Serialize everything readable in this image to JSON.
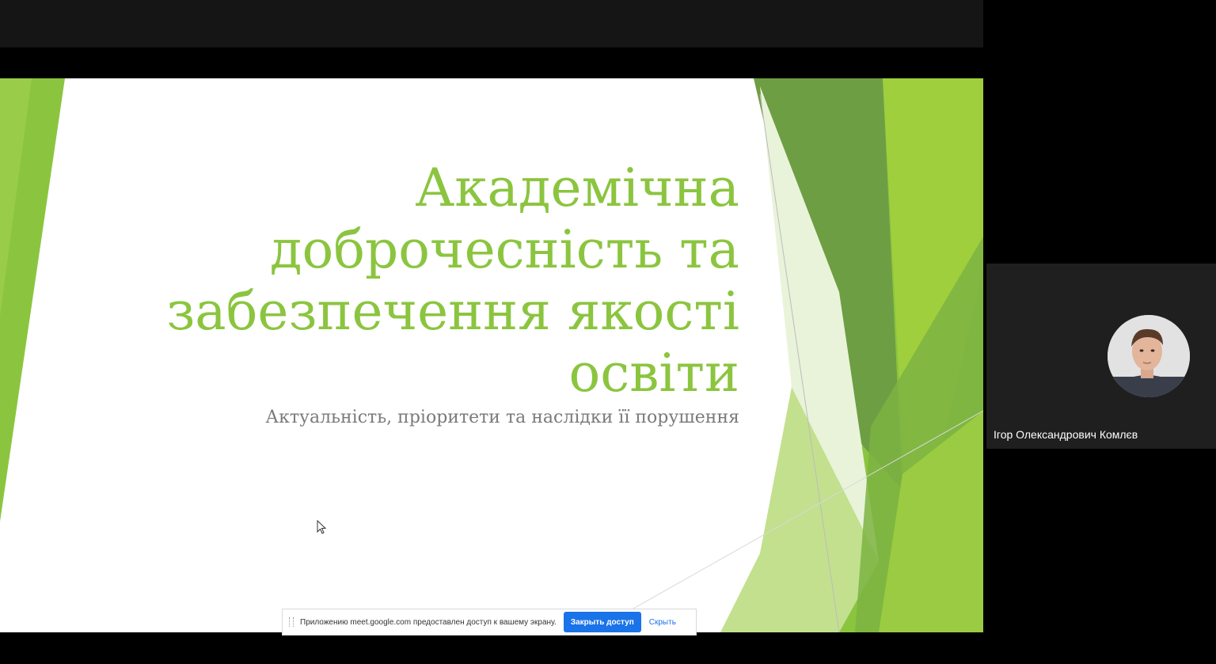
{
  "slide": {
    "title_lines": [
      "Академічна",
      "доброчесність та",
      "забезпечення якості",
      "освіти"
    ],
    "subtitle": "Актуальність, пріоритети та наслідки її порушення"
  },
  "share_bar": {
    "message": "Приложению meet.google.com предоставлен доступ к вашему экрану.",
    "stop_label": "Закрыть доступ",
    "hide_label": "Скрыть"
  },
  "participant": {
    "name": "Ігор Олександрович Комлєв"
  },
  "colors": {
    "accent_green": "#8bc53f",
    "button_blue": "#1a73e8",
    "tile_bg": "#1f1f1f"
  },
  "icons": {
    "cursor": "mouse-pointer-icon",
    "grip": "drag-handle-icon"
  }
}
